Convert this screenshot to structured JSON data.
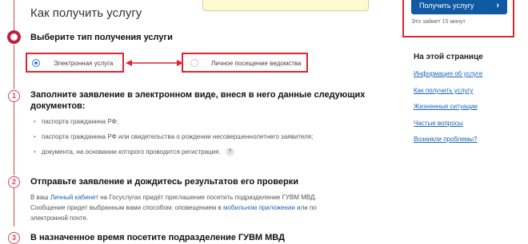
{
  "page": {
    "title": "Как получить услугу"
  },
  "steps": {
    "choose": {
      "heading": "Выберите тип получения услуги",
      "options": [
        {
          "label": "Электронная услуга",
          "selected": true
        },
        {
          "label": "Личное посещение ведомства",
          "selected": false
        }
      ]
    },
    "step1": {
      "number": "1",
      "heading": "Заполните заявление в электронном виде, внеся в него данные следующих документов:",
      "bullets": [
        "паспорта гражданина РФ;",
        "паспорта гражданина РФ или свидетельства о рождении несовершеннолетнего заявителя;",
        "документа, на основании которого проводится регистрация."
      ],
      "help_icon": "?"
    },
    "step2": {
      "number": "2",
      "heading": "Отправьте заявление и дождитесь результатов его проверки",
      "text_before": "В ваш ",
      "link1": "Личный кабинет",
      "text_mid": " на Госуслугах придёт приглашение посетить подразделение ГУВМ МВД. Сообщение придет выбранным вами способом: оповещением в ",
      "link2": "мобильном приложении",
      "text_after": " или по электронной почте."
    },
    "step3": {
      "number": "3",
      "heading": "В назначенное время посетите подразделение ГУВМ МВД"
    }
  },
  "sidebar": {
    "cta_label": "Получить услугу",
    "duration": "Это займет 15 минут",
    "toc_title": "На этой странице",
    "toc_links": [
      "Информация об услуге",
      "Как получить услугу",
      "Жизненные ситуации",
      "Частые вопросы",
      "Возникли проблемы?"
    ]
  },
  "colors": {
    "accent": "#0f5aa3",
    "highlight": "#e0242f",
    "step": "#c01f3f"
  }
}
